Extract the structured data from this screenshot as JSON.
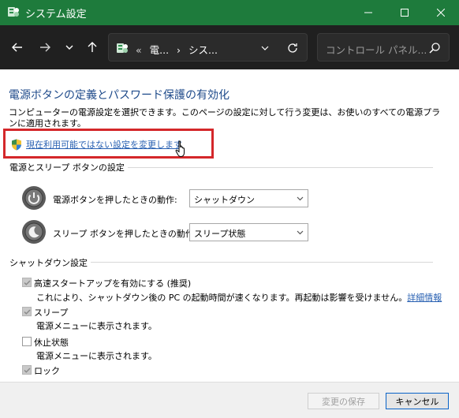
{
  "window": {
    "title": "システム設定",
    "minimize": "minimize",
    "maximize": "maximize",
    "close": "close"
  },
  "nav": {
    "crumbs": [
      "«",
      "電...",
      "›",
      "シス..."
    ],
    "search_placeholder": "コントロール パネル..."
  },
  "page": {
    "heading": "電源ボタンの定義とパスワード保護の有効化",
    "description": "コンピューターの電源設定を選択できます。このページの設定に対して行う変更は、お使いのすべての電源プランに適用されます。",
    "change_link": "現在利用可能ではない設定を変更します"
  },
  "power_section": {
    "title": "電源とスリープ ボタンの設定",
    "rows": [
      {
        "label": "電源ボタンを押したときの動作:",
        "value": "シャットダウン"
      },
      {
        "label": "スリープ ボタンを押したときの動作:",
        "value": "スリープ状態"
      }
    ]
  },
  "shutdown_section": {
    "title": "シャットダウン設定",
    "items": [
      {
        "label": "高速スタートアップを有効にする (推奨)",
        "checked": true,
        "description": "これにより、シャットダウン後の PC の起動時間が速くなります。再起動は影響を受けません。",
        "more_link": "詳細情報"
      },
      {
        "label": "スリープ",
        "checked": true,
        "description": "電源メニューに表示されます。"
      },
      {
        "label": "休止状態",
        "checked": false,
        "description": "電源メニューに表示されます。"
      },
      {
        "label": "ロック",
        "checked": true
      }
    ]
  },
  "footer": {
    "save_label": "変更の保存",
    "cancel_label": "キャンセル"
  },
  "colors": {
    "titlebar": "#1e7b3c",
    "navbar": "#202020",
    "heading": "#1e4a8a",
    "link": "#2860b2",
    "highlight": "#d4272a"
  }
}
